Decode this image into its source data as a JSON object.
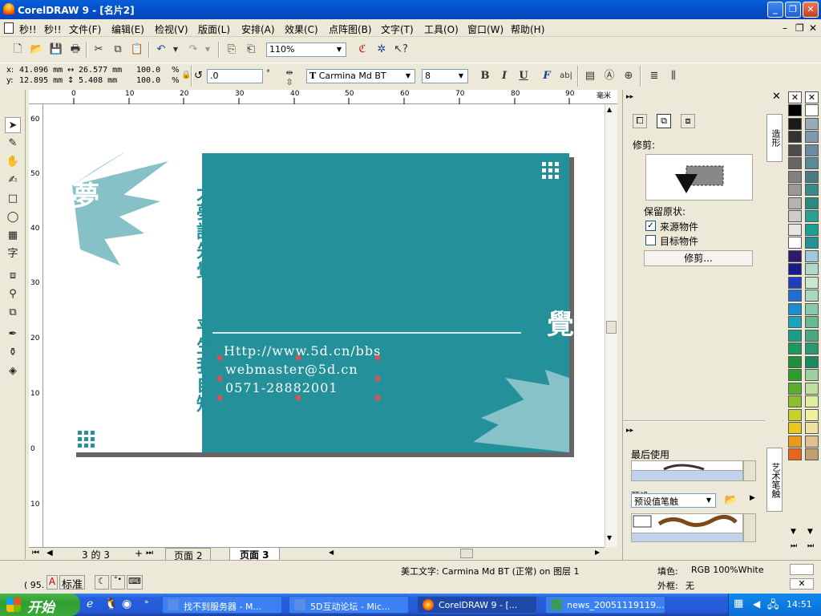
{
  "window": {
    "title": "CorelDRAW 9 - [名片2]",
    "minimize": "_",
    "restore": "❐",
    "close": "✕"
  },
  "menu": {
    "items": [
      "秒!!",
      "秒!!",
      "文件(F)",
      "编辑(E)",
      "检视(V)",
      "版面(L)",
      "安排(A)",
      "效果(C)",
      "点阵图(B)",
      "文字(T)",
      "工具(O)",
      "窗口(W)",
      "帮助(H)"
    ],
    "doc_controls": [
      "–",
      "❐",
      "✕"
    ]
  },
  "toolbar": {
    "zoom": "110%"
  },
  "propertybar": {
    "x_label": "x:",
    "x_value": "41.096 mm",
    "y_label": "y:",
    "y_value": "12.895 mm",
    "w_value": "26.577 mm",
    "h_value": "5.408 mm",
    "scale_x": "100.0",
    "scale_y": "100.0",
    "pct": "%",
    "rotation": ".0",
    "degree": "°",
    "font_name": "Carmina Md BT",
    "font_size": "8",
    "bold": "B",
    "italic": "I",
    "underline": "U",
    "fontform": "F",
    "abl": "ab|"
  },
  "ruler": {
    "unit": "毫米",
    "h_ticks": [
      "0",
      "10",
      "20",
      "30",
      "40",
      "50",
      "60",
      "70",
      "80",
      "90"
    ],
    "v_ticks": [
      "60",
      "50",
      "40",
      "30",
      "20",
      "10",
      "0",
      "10"
    ]
  },
  "card": {
    "vertical_line1": "大夢誰先覺",
    "vertical_line2": "平生我自知",
    "corner_glyph_left": "夢",
    "corner_glyph_right": "覺",
    "website": "Http://www.5d.cn/bbs",
    "email": "webmaster@5d.cn",
    "phone": "0571-28882001"
  },
  "pagenav": {
    "counter": "3 的 3",
    "tabs": [
      "页面 2",
      "页面 3"
    ]
  },
  "status": {
    "coords": "( 95.",
    "style": "标准",
    "object_info": "美工文字: Carmina Md BT (正常) on 图层 1",
    "fill_label": "填色:",
    "fill_value": "RGB 100%White",
    "outline_label": "外框:",
    "outline_value": "无"
  },
  "docker_shaping": {
    "title": "修剪:",
    "keep_original": "保留原状:",
    "source_label": "来源物件",
    "source_checked": true,
    "target_label": "目标物件",
    "target_checked": false,
    "apply_button": "修剪...",
    "tab_label": "造形"
  },
  "docker_artistic": {
    "recent_label": "最后使用",
    "preset_label": "预设值笔触",
    "partial_label": "预设",
    "tab_label": "艺术笔触"
  },
  "palette": {
    "colors_col1": [
      "#000000",
      "#1a1a1a",
      "#333333",
      "#4d4d4d",
      "#666666",
      "#808080",
      "#999999",
      "#b3b3b3",
      "#cccccc",
      "#e6e6e6",
      "#ffffff",
      "#2e1a6b",
      "#1a1a8c",
      "#1f3fbf",
      "#1f6fd6",
      "#1a8fd0",
      "#1aa6b8",
      "#1a9e8a",
      "#1a9a5c",
      "#1f8f3a",
      "#2aa02a",
      "#5ab02a",
      "#8cc02a",
      "#c8d02a",
      "#e8c81a",
      "#e89a1a",
      "#e8661a"
    ],
    "colors_col2": [
      "#ffffff",
      "#9aaab8",
      "#7e9aae",
      "#6c8aa0",
      "#5a8a9a",
      "#4a7a86",
      "#3a8a8a",
      "#2a8a80",
      "#2aa090",
      "#1aa090",
      "#23909a",
      "#a0c8d8",
      "#b0d8c8",
      "#c8e8d0",
      "#a8d8c0",
      "#88c8b0",
      "#68b890",
      "#48a880",
      "#2a9870",
      "#1a8860",
      "#a0d0a0",
      "#c0e0a0",
      "#e0f0a0",
      "#f0f0a0",
      "#f0e0a0",
      "#e0c090",
      "#c0a070"
    ]
  },
  "taskbar": {
    "start": "开始",
    "tasks": [
      "找不到服务器 - M...",
      "5D互动论坛 - Mic...",
      "CorelDRAW 9 - [...",
      "news_20051119119..."
    ],
    "clock": "14:51"
  }
}
